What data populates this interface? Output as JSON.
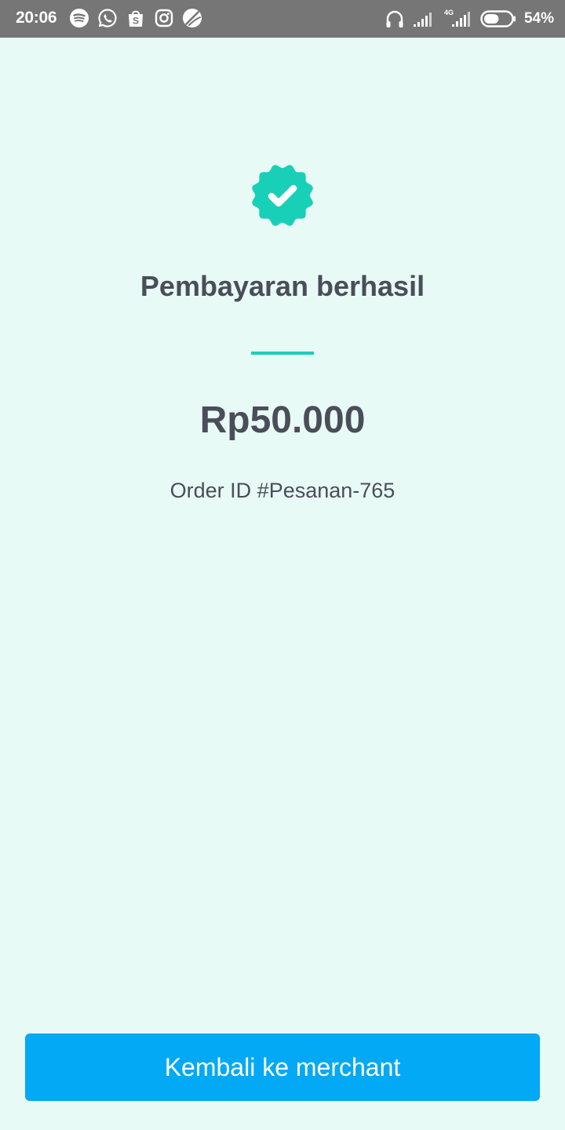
{
  "status_bar": {
    "time": "20:06",
    "network_label": "4G",
    "battery_percent": "54%",
    "battery_level": 0.54,
    "notification_icons": [
      "spotify-icon",
      "whatsapp-icon",
      "shopping-bag-icon",
      "instagram-icon",
      "music-app-icon"
    ],
    "system_icons": [
      "headphones-icon",
      "signal-icon",
      "signal-4g-icon",
      "battery-icon"
    ]
  },
  "payment": {
    "status_icon": "verified-check-icon",
    "title": "Pembayaran berhasil",
    "amount": "Rp50.000",
    "order_id": "Order ID #Pesanan-765"
  },
  "actions": {
    "back_label": "Kembali ke merchant"
  },
  "colors": {
    "background": "#e8faf6",
    "accent": "#17d0b7",
    "button": "#03a9f4",
    "text": "#4a4e59",
    "status_bar": "#767676"
  }
}
